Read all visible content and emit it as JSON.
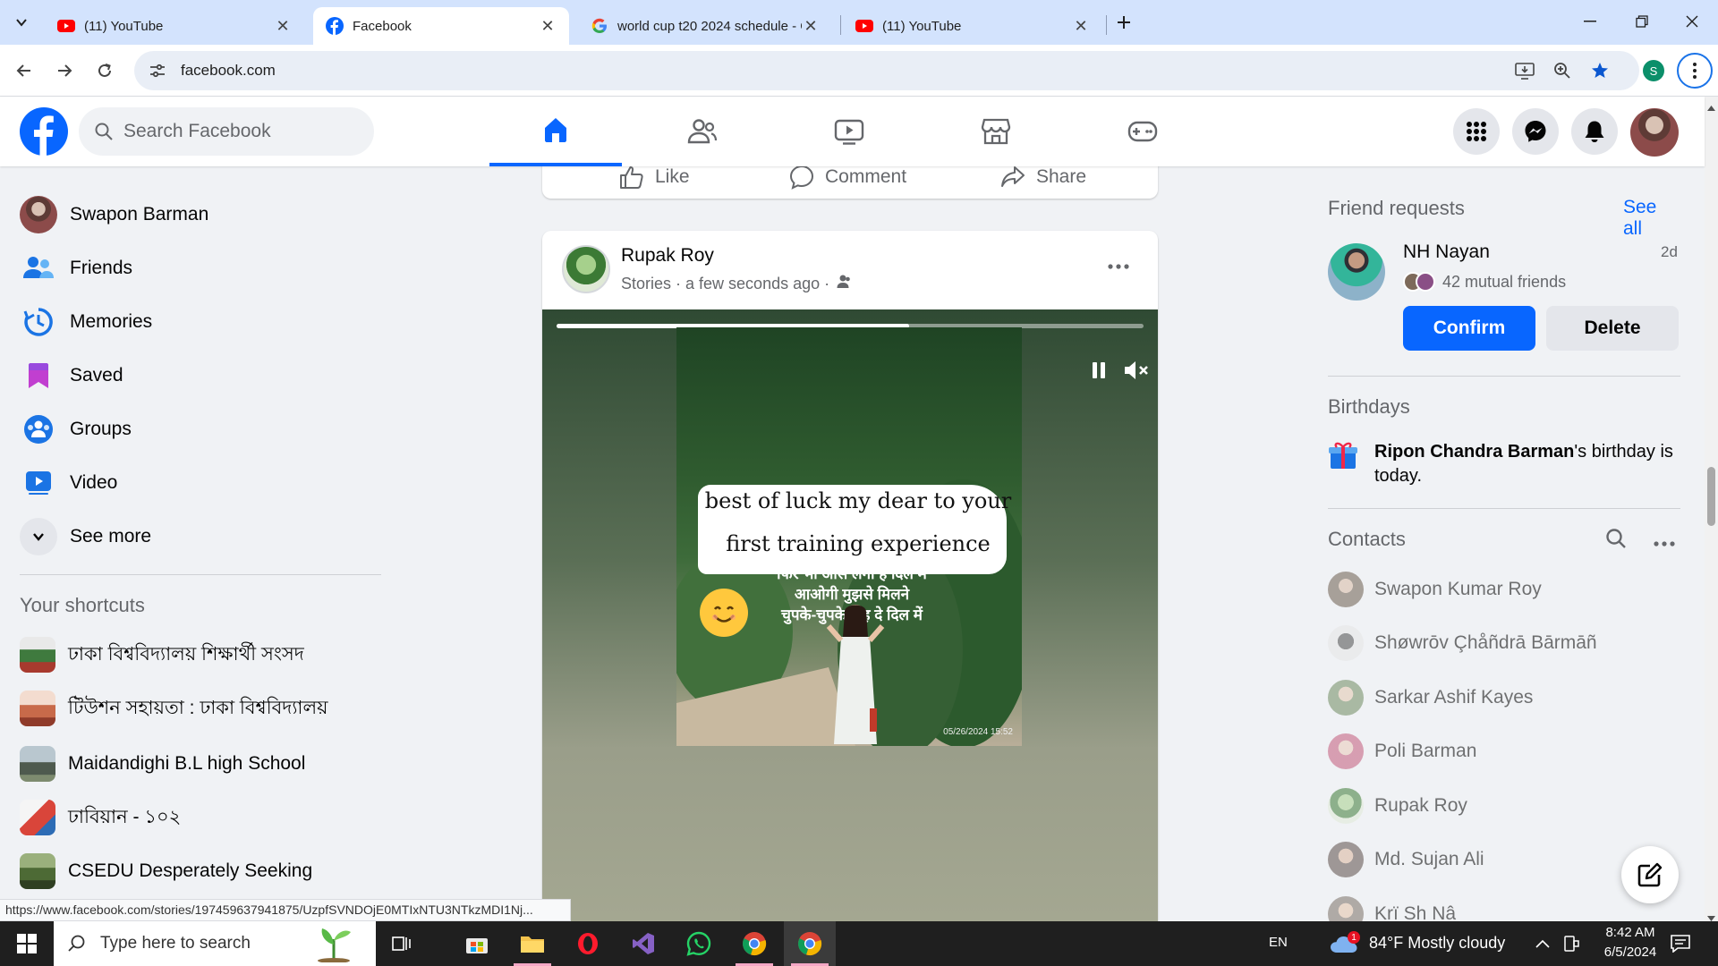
{
  "browser": {
    "tabs": [
      {
        "title": "(11) YouTube",
        "favicon": "youtube-icon",
        "active": false
      },
      {
        "title": "Facebook",
        "favicon": "facebook-icon",
        "active": true
      },
      {
        "title": "world cup t20 2024 schedule - Google",
        "favicon": "google-icon",
        "active": false
      },
      {
        "title": "(11) YouTube",
        "favicon": "youtube-icon",
        "active": false
      }
    ],
    "url": "facebook.com",
    "profile_initial": "S"
  },
  "facebook": {
    "search_placeholder": "Search Facebook",
    "brand_color": "#0866ff",
    "left_nav": [
      {
        "label": "Swapon Barman",
        "icon": "profile-avatar"
      },
      {
        "label": "Friends",
        "icon": "friends-icon"
      },
      {
        "label": "Memories",
        "icon": "memories-clock-icon"
      },
      {
        "label": "Saved",
        "icon": "saved-bookmark-icon"
      },
      {
        "label": "Groups",
        "icon": "groups-icon"
      },
      {
        "label": "Video",
        "icon": "video-icon"
      },
      {
        "label": "See more",
        "icon": "chevron-down-icon"
      }
    ],
    "shortcuts_heading": "Your shortcuts",
    "shortcuts": [
      {
        "label": "ঢাকা বিশ্ববিদ্যালয় শিক্ষার্থী সংসদ"
      },
      {
        "label": "টিউশন সহায়তা : ঢাকা বিশ্ববিদ্যালয়"
      },
      {
        "label": "Maidandighi B.L high School"
      },
      {
        "label": "ঢাবিয়ান - ১০২"
      },
      {
        "label": "CSEDU Desperately Seeking"
      }
    ],
    "post_actions": {
      "like": "Like",
      "comment": "Comment",
      "share": "Share"
    },
    "story": {
      "author": "Rupak Roy",
      "meta": "Stories · a few seconds ago ·",
      "progress": 0.6,
      "caption_line1": "best of luck my dear to your",
      "caption_line2": "first training experience",
      "hindi_line1": "फिर भी आस लगी है दिल में",
      "hindi_line2": "आओगी मुझसे मिलने",
      "hindi_line3": "चुपके-चुपके कह दे दिल में",
      "timestamp": "05/26/2024 15:52"
    },
    "friend_requests": {
      "heading": "Friend requests",
      "see_all": "See all",
      "name": "NH Nayan",
      "age": "2d",
      "mutual": "42 mutual friends",
      "confirm": "Confirm",
      "delete": "Delete"
    },
    "birthdays": {
      "heading": "Birthdays",
      "name": "Ripon Chandra Barman",
      "text_after": "'s birthday is today."
    },
    "contacts": {
      "heading": "Contacts",
      "list": [
        {
          "name": "Swapon Kumar Roy"
        },
        {
          "name": "Shøwrōv Çhåñdrā Bārmāñ"
        },
        {
          "name": "Sarkar Ashif Kayes"
        },
        {
          "name": "Poli Barman"
        },
        {
          "name": "Rupak Roy"
        },
        {
          "name": "Md. Sujan Ali"
        },
        {
          "name": "Krï Sh Nâ"
        }
      ]
    }
  },
  "status_url": "https://www.facebook.com/stories/197459637941875/UzpfSVNDOjE0MTIxNTU3NTkzMDI1Nj...",
  "taskbar": {
    "search_placeholder": "Type here to search",
    "language": "EN",
    "weather": "84°F  Mostly cloudy",
    "weather_badge": "1",
    "time": "8:42 AM",
    "date": "6/5/2024"
  }
}
